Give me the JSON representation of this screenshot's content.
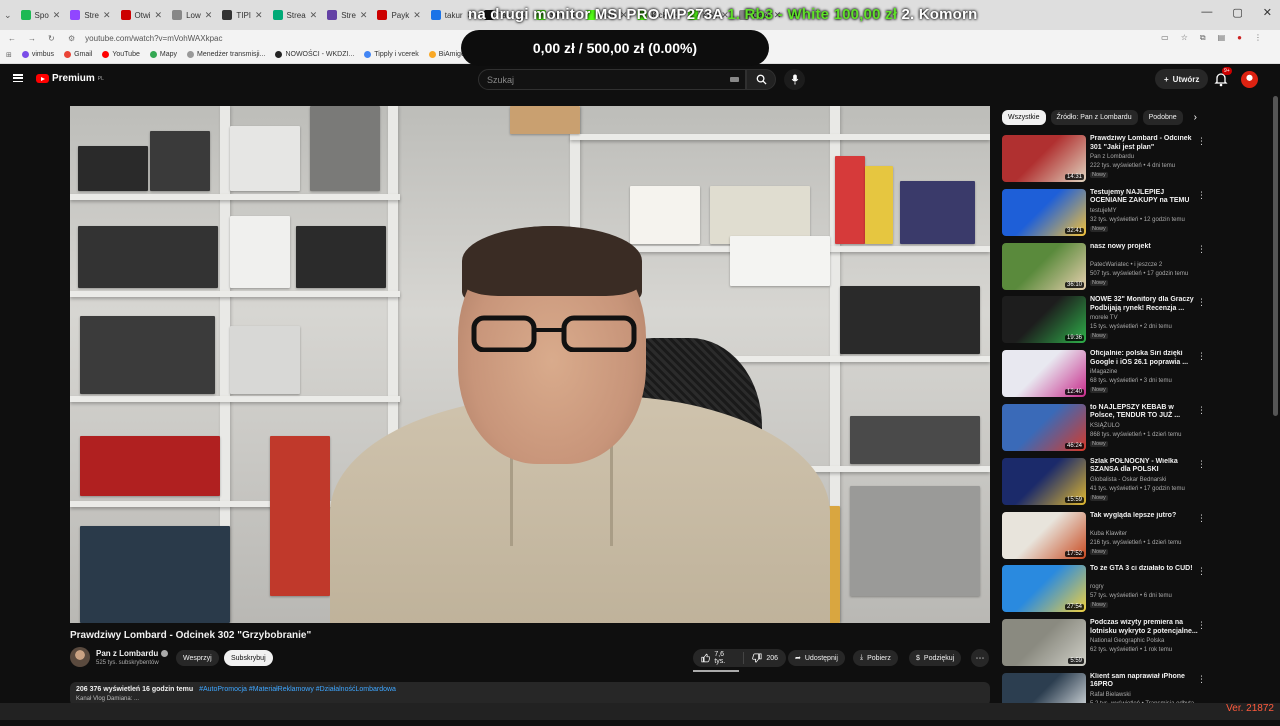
{
  "browser": {
    "tabs": [
      {
        "label": "Spo",
        "color": "#1db954"
      },
      {
        "label": "Stre",
        "color": "#9146ff"
      },
      {
        "label": "Otwi",
        "color": "#c00"
      },
      {
        "label": "Low",
        "color": "#888"
      },
      {
        "label": "TIPI",
        "color": "#333"
      },
      {
        "label": "Strea",
        "color": "#0a7"
      },
      {
        "label": "Stre",
        "color": "#6441a5"
      },
      {
        "label": "Payk",
        "color": "#c00"
      },
      {
        "label": "takur",
        "color": "#1a73e8"
      },
      {
        "label": "Takk",
        "color": "#111"
      },
      {
        "label": "Stre",
        "color": "#53fc18"
      },
      {
        "label": "Achi",
        "color": "#53fc18"
      },
      {
        "label": "Kick",
        "color": "#53fc18"
      },
      {
        "label": "Kick",
        "color": "#53fc18"
      },
      {
        "label": "Capt",
        "color": "#888"
      }
    ],
    "url": "youtube.com/watch?v=mVohWAXkpac",
    "bookmarks": [
      {
        "label": "vimbus",
        "color": "#7a4de8"
      },
      {
        "label": "Gmail",
        "color": "#ea4335"
      },
      {
        "label": "YouTube",
        "color": "#ff0000"
      },
      {
        "label": "Mapy",
        "color": "#34a853"
      },
      {
        "label": "Menedżer transmisji...",
        "color": "#999"
      },
      {
        "label": "NOWOŚCI - WKDZI...",
        "color": "#222"
      },
      {
        "label": "Tipply i vcerek",
        "color": "#4285f4"
      },
      {
        "label": "BiAmigos official site",
        "color": "#f9a825"
      }
    ],
    "window_controls": [
      "—",
      "▢",
      "✕"
    ]
  },
  "overlay": {
    "banner_left": "na drugi monitor MSI PRO MP273A",
    "banner_mid": "1. Rb3 - White ",
    "banner_amount": "100,00 zł",
    "banner_right": " 2. Komorn",
    "donation_goal": "0,00 zł / 500,00 zł (0.00%)",
    "version": "Ver. 21872"
  },
  "header": {
    "logo_text": "Premium",
    "logo_country": "PL",
    "search_placeholder": "Szukaj",
    "create_label": "Utwórz",
    "notification_count": "9+"
  },
  "video": {
    "title": "Prawdziwy Lombard - Odcinek 302 \"Grzybobranie\"",
    "channel": "Pan z Lombardu",
    "subscribers": "525 tys. subskrybentów",
    "support_label": "Wesprzyj",
    "subscribe_label": "Subskrybuj",
    "likes": "7,6 tys.",
    "dislikes": "206",
    "share_label": "Udostępnij",
    "download_label": "Pobierz",
    "thanks_label": "Podziękuj",
    "views_date": "206 376 wyświetleń  16 godzin temu",
    "tags": "#AutoPromocja #MateriałReklamowy #DziałalnośćLombardowa",
    "desc_line2": "Kanał Vlog Damiana: ..."
  },
  "sidebar": {
    "chips": [
      "Wszystkie",
      "Źródło: Pan z Lombardu",
      "Podobne"
    ],
    "items": [
      {
        "title": "Prawdziwy Lombard - Odcinek 301 \"Jaki jest plan\"",
        "channel": "Pan z Lombardu",
        "meta": "222 tys. wyświetleń • 4 dni temu",
        "badge": "Nowy",
        "duration": "14:31",
        "colors": [
          "#b03030",
          "#e0d4c0"
        ]
      },
      {
        "title": "Testujemy NAJLEPIEJ OCENIANE ZAKUPY na TEMU",
        "channel": "testujeMY",
        "meta": "32 tys. wyświetleń • 12 godzin temu",
        "badge": "Nowy",
        "duration": "32:41",
        "colors": [
          "#1e5fd8",
          "#f4c23a"
        ]
      },
      {
        "title": "nasz nowy projekt",
        "channel": "PatecWariatec • i jeszcze 2",
        "meta": "507 tys. wyświetleń • 17 godzin temu",
        "badge": "Nowy",
        "duration": "36:10",
        "colors": [
          "#5a8a3c",
          "#e8d0b0"
        ]
      },
      {
        "title": "NOWE 32\" Monitory dla Graczy Podbijają rynek! Recenzja ...",
        "channel": "morele TV",
        "meta": "15 tys. wyświetleń • 2 dni temu",
        "badge": "Nowy",
        "duration": "19:36",
        "colors": [
          "#1d1d1d",
          "#2fb14a"
        ]
      },
      {
        "title": "Oficjalnie: polska Siri dzięki Google i iOS 26.1 poprawia ...",
        "channel": "iMagazine",
        "meta": "68 tys. wyświetleń • 3 dni temu",
        "badge": "Nowy",
        "duration": "12:40",
        "colors": [
          "#e8e8f0",
          "#c72a8a"
        ]
      },
      {
        "title": "to NAJLEPSZY KEBAB w Polsce, TENDUR TO JUŻ ...",
        "channel": "KSIĄŻULO",
        "meta": "868 tys. wyświetleń • 1 dzień temu",
        "badge": "Nowy",
        "duration": "46:24",
        "colors": [
          "#3a6ab8",
          "#d63a2a"
        ]
      },
      {
        "title": "Szlak PÓŁNOCNY - Wielka SZANSA dla POLSKI",
        "channel": "Globalista - Oskar Bednarski",
        "meta": "41 tys. wyświetleń • 17 godzin temu",
        "badge": "Nowy",
        "duration": "15:59",
        "colors": [
          "#1b2a6a",
          "#e0b830"
        ]
      },
      {
        "title": "Tak wygląda lepsze jutro?",
        "channel": "Kuba Klawiter",
        "meta": "216 tys. wyświetleń • 1 dzień temu",
        "badge": "Nowy",
        "duration": "17:52",
        "colors": [
          "#e8e4dc",
          "#c84a20"
        ]
      },
      {
        "title": "To że GTA 3 ci działało to CUD!",
        "channel": "rogry",
        "meta": "57 tys. wyświetleń • 6 dni temu",
        "badge": "Nowy",
        "duration": "27:54",
        "colors": [
          "#2a8adf",
          "#f0d040"
        ]
      },
      {
        "title": "Podczas wizyty premiera na lotnisku wykryto 2 potencjalne...",
        "channel": "National Geographic Polska",
        "meta": "62 tys. wyświetleń • 1 rok temu",
        "badge": "",
        "duration": "5:59",
        "colors": [
          "#8a8a80",
          "#d0d0c8"
        ]
      },
      {
        "title": "Klient sam naprawiał iPhone 16PRO",
        "channel": "Rafał Bielawski",
        "meta": "5,2 tys. wyświetleń • Transmisja odbyta",
        "badge": "",
        "duration": "",
        "colors": [
          "#2c3e50",
          "#ecf0f1"
        ]
      }
    ]
  },
  "colors": {
    "accent": "#ff0000",
    "bg": "#0f0f0f",
    "chip_bg": "#272727"
  }
}
